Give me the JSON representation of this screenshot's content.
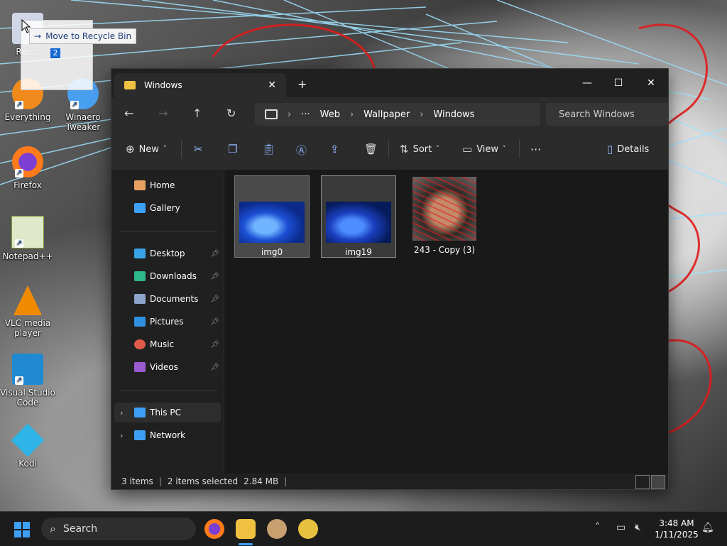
{
  "desktop": {
    "icons": [
      {
        "label": "Rec..."
      },
      {
        "label": "Everything"
      },
      {
        "label": "Winaero Tweaker"
      },
      {
        "label": "Firefox"
      },
      {
        "label": "Notepad++"
      },
      {
        "label": "VLC media player"
      },
      {
        "label": "Visual Studio Code"
      },
      {
        "label": "Kodi"
      }
    ],
    "drag_tooltip": "Move to Recycle Bin",
    "drag_count": "2"
  },
  "explorer": {
    "tab_title": "Windows",
    "address": {
      "crumbs": [
        "Web",
        "Wallpaper",
        "Windows"
      ],
      "more": "···"
    },
    "search_placeholder": "Search Windows",
    "toolbar": {
      "new_label": "New",
      "sort_label": "Sort",
      "view_label": "View",
      "more": "···",
      "details_label": "Details"
    },
    "nav": {
      "top": [
        {
          "label": "Home"
        },
        {
          "label": "Gallery"
        }
      ],
      "quick": [
        {
          "label": "Desktop"
        },
        {
          "label": "Downloads"
        },
        {
          "label": "Documents"
        },
        {
          "label": "Pictures"
        },
        {
          "label": "Music"
        },
        {
          "label": "Videos"
        }
      ],
      "bottom": [
        {
          "label": "This PC"
        },
        {
          "label": "Network"
        }
      ]
    },
    "files": [
      {
        "name": "img0",
        "state": "selected"
      },
      {
        "name": "img19",
        "state": "selected"
      },
      {
        "name": "243 - Copy (3)",
        "state": "normal"
      }
    ],
    "status": {
      "items": "3 items",
      "selected": "2 items selected",
      "size": "2.84 MB"
    }
  },
  "taskbar": {
    "search_label": "Search",
    "time": "3:48 AM",
    "date": "1/11/2025"
  },
  "colors": {
    "accent": "#3ea0f5",
    "window_bg": "#202020",
    "content_bg": "#191919"
  }
}
